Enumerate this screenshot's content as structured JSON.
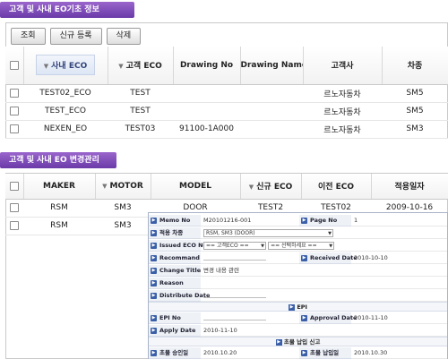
{
  "section1": {
    "title": "고객 및 사내 EO기초 정보",
    "buttons": {
      "search": "조회",
      "new": "신규 등록",
      "delete": "삭제"
    },
    "columns": [
      "사내 ECO",
      "고객 ECO",
      "Drawing No",
      "Drawing Name",
      "고객사",
      "차종"
    ],
    "rows": [
      {
        "eco": "TEST02_ECO",
        "cust_eco": "TEST",
        "drawing_no": "",
        "drawing_name": "",
        "customer": "르노자동차",
        "model": "SM5"
      },
      {
        "eco": "TEST_ECO",
        "cust_eco": "TEST",
        "drawing_no": "",
        "drawing_name": "",
        "customer": "르노자동차",
        "model": "SM5"
      },
      {
        "eco": "NEXEN_EO",
        "cust_eco": "TEST03",
        "drawing_no": "91100-1A000",
        "drawing_name": "",
        "customer": "르노자동차",
        "model": "SM3"
      }
    ]
  },
  "section2": {
    "title": "고객 및 사내 EO 변경관리",
    "columns": [
      "MAKER",
      "MOTOR",
      "MODEL",
      "신규 ECO",
      "이전 ECO",
      "적용일자"
    ],
    "rows": [
      {
        "maker": "RSM",
        "motor": "SM3",
        "model": "DOOR",
        "new_eco": "TEST2",
        "prev_eco": "TEST02",
        "date": "2009-10-16"
      },
      {
        "maker": "RSM",
        "motor": "SM3",
        "model": "",
        "new_eco": "",
        "prev_eco": "",
        "date": ""
      }
    ]
  },
  "detail": {
    "memo_no_label": "Memo No",
    "memo_no": "M20101216-001",
    "page_no_label": "Page No",
    "page_no": "1",
    "apply_model_label": "적용 차종",
    "apply_model": "RSM, SM3 (DOOR)",
    "issued_eco_label": "Issued ECO No",
    "issued_eco_select1": "== 고객ECO ==",
    "issued_eco_select2": "== 선택하세요 ==",
    "recommand_label": "Recommand",
    "received_date_label": "Received Date",
    "received_date": "2010-10-10",
    "change_title_label": "Change Title",
    "change_title": "변경 내용 관련",
    "reason_label": "Reason",
    "distribute_date_label": "Distribute Date",
    "epi_band": "EPI",
    "epi_no_label": "EPI No",
    "approval_date_label": "Approval Date",
    "approval_date": "2010-11-10",
    "apply_date_label": "Apply Date",
    "apply_date": "2010-11-10",
    "delivery_band": "초물 납입 신고",
    "first_approval_label": "초물 승인일",
    "first_approval": "2010.10.20",
    "first_delivery_label": "초물 납입일",
    "first_delivery": "2010.10.30"
  }
}
